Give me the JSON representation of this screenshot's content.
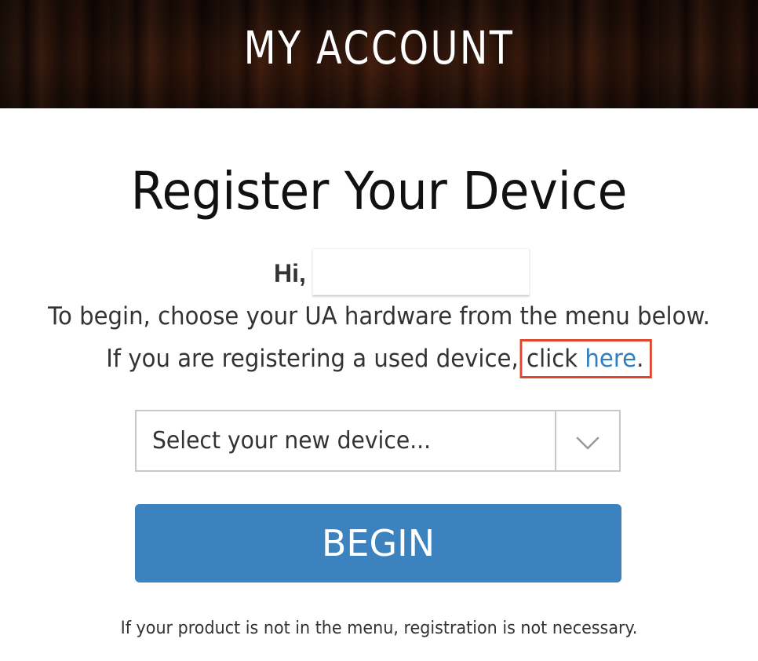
{
  "header": {
    "title": "MY ACCOUNT"
  },
  "main": {
    "title": "Register Your Device",
    "greeting": {
      "label": "Hi,",
      "name_value": ""
    },
    "intro_text": "To begin, choose your UA hardware from the menu below.",
    "used_device": {
      "prefix": "If you are registering a used device,",
      "click_word": "click",
      "link_text": "here",
      "suffix": "."
    },
    "device_select": {
      "selected_value": "Select your new device...",
      "arrow_icon": "chevron-down-icon"
    },
    "begin_button_label": "BEGIN",
    "footer_note": "If your product is not in the menu, registration is not necessary."
  },
  "colors": {
    "link": "#2f7ec1",
    "button": "#3b82bf",
    "highlight_box": "#e0442c"
  }
}
